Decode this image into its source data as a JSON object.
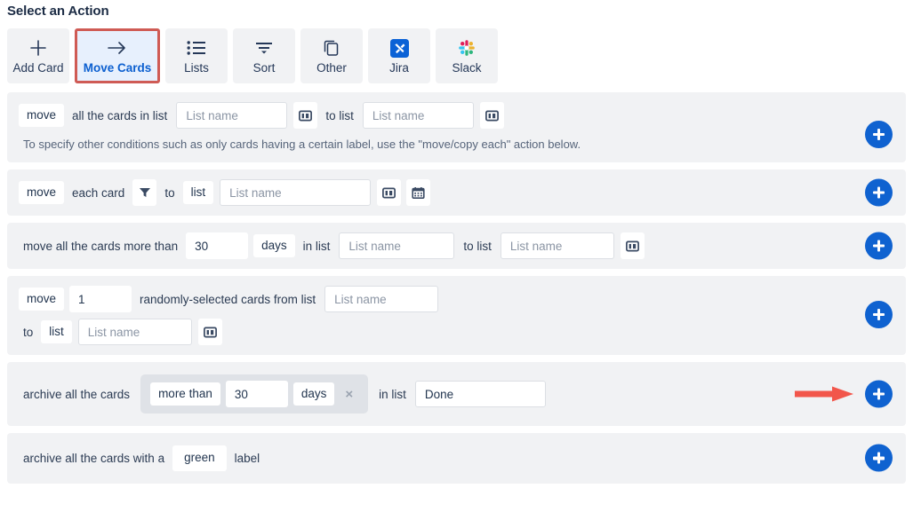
{
  "page_title": "Select an Action",
  "colors": {
    "accent_blue": "#0f62d0",
    "highlight_red": "#cf5b55",
    "row_bg": "#f1f2f4",
    "group_bg": "#dfe2e7",
    "text": "#2a3b53"
  },
  "toolbar": {
    "items": [
      {
        "label": "Add Card",
        "icon": "plus-icon",
        "selected": false
      },
      {
        "label": "Move Cards",
        "icon": "arrow-right-icon",
        "selected": true
      },
      {
        "label": "Lists",
        "icon": "bulleted-list-icon",
        "selected": false
      },
      {
        "label": "Sort",
        "icon": "sort-funnel-icon",
        "selected": false
      },
      {
        "label": "Other",
        "icon": "copy-icon",
        "selected": false
      },
      {
        "label": "Jira",
        "icon": "jira-icon",
        "selected": false
      },
      {
        "label": "Slack",
        "icon": "slack-icon",
        "selected": false
      }
    ]
  },
  "rows": [
    {
      "name": "move-all-cards-in-list",
      "tokens": {
        "verb": "move",
        "phrase1": "all the cards in list",
        "list_from_placeholder": "List name",
        "board_icon_1": "board-icon",
        "phrase2": "to list",
        "list_to_placeholder": "List name",
        "board_icon_2": "board-icon"
      },
      "hint": "To specify other conditions such as only cards having a certain label, use the \"move/copy each\" action below.",
      "add_button": "add-rule-button"
    },
    {
      "name": "move-each-card",
      "tokens": {
        "verb": "move",
        "phrase1": "each card",
        "filter_icon": "filter-icon",
        "phrase2": "to",
        "chip_list": "list",
        "list_placeholder": "List name",
        "board_icon": "board-icon",
        "calendar_icon": "calendar-icon"
      },
      "add_button": "add-rule-button"
    },
    {
      "name": "move-cards-older-than",
      "tokens": {
        "phrase1": "move all the cards more than",
        "days_value": "30",
        "chip_days": "days",
        "phrase2": "in list",
        "list_from_placeholder": "List name",
        "phrase3": "to list",
        "list_to_placeholder": "List name",
        "board_icon": "board-icon"
      },
      "add_button": "add-rule-button"
    },
    {
      "name": "move-randomly-selected-cards",
      "tokens": {
        "verb": "move",
        "count_value": "1",
        "phrase1": "randomly-selected cards from list",
        "list_from_placeholder": "List name",
        "phrase2": "to",
        "chip_list": "list",
        "list_to_placeholder": "List name",
        "board_icon": "board-icon"
      },
      "add_button": "add-rule-button"
    },
    {
      "name": "archive-cards-older-than",
      "tokens": {
        "phrase1": "archive all the cards",
        "chip_more_than": "more than",
        "days_value": "30",
        "chip_days": "days",
        "remove_icon": "×",
        "phrase2": "in list",
        "list_value": "Done"
      },
      "annotation": "red-arrow-pointing-to-add-button",
      "add_button": "add-rule-button"
    },
    {
      "name": "archive-cards-with-label",
      "tokens": {
        "phrase1": "archive all the cards with a",
        "chip_color": "green",
        "phrase2": "label"
      },
      "add_button": "add-rule-button"
    }
  ]
}
